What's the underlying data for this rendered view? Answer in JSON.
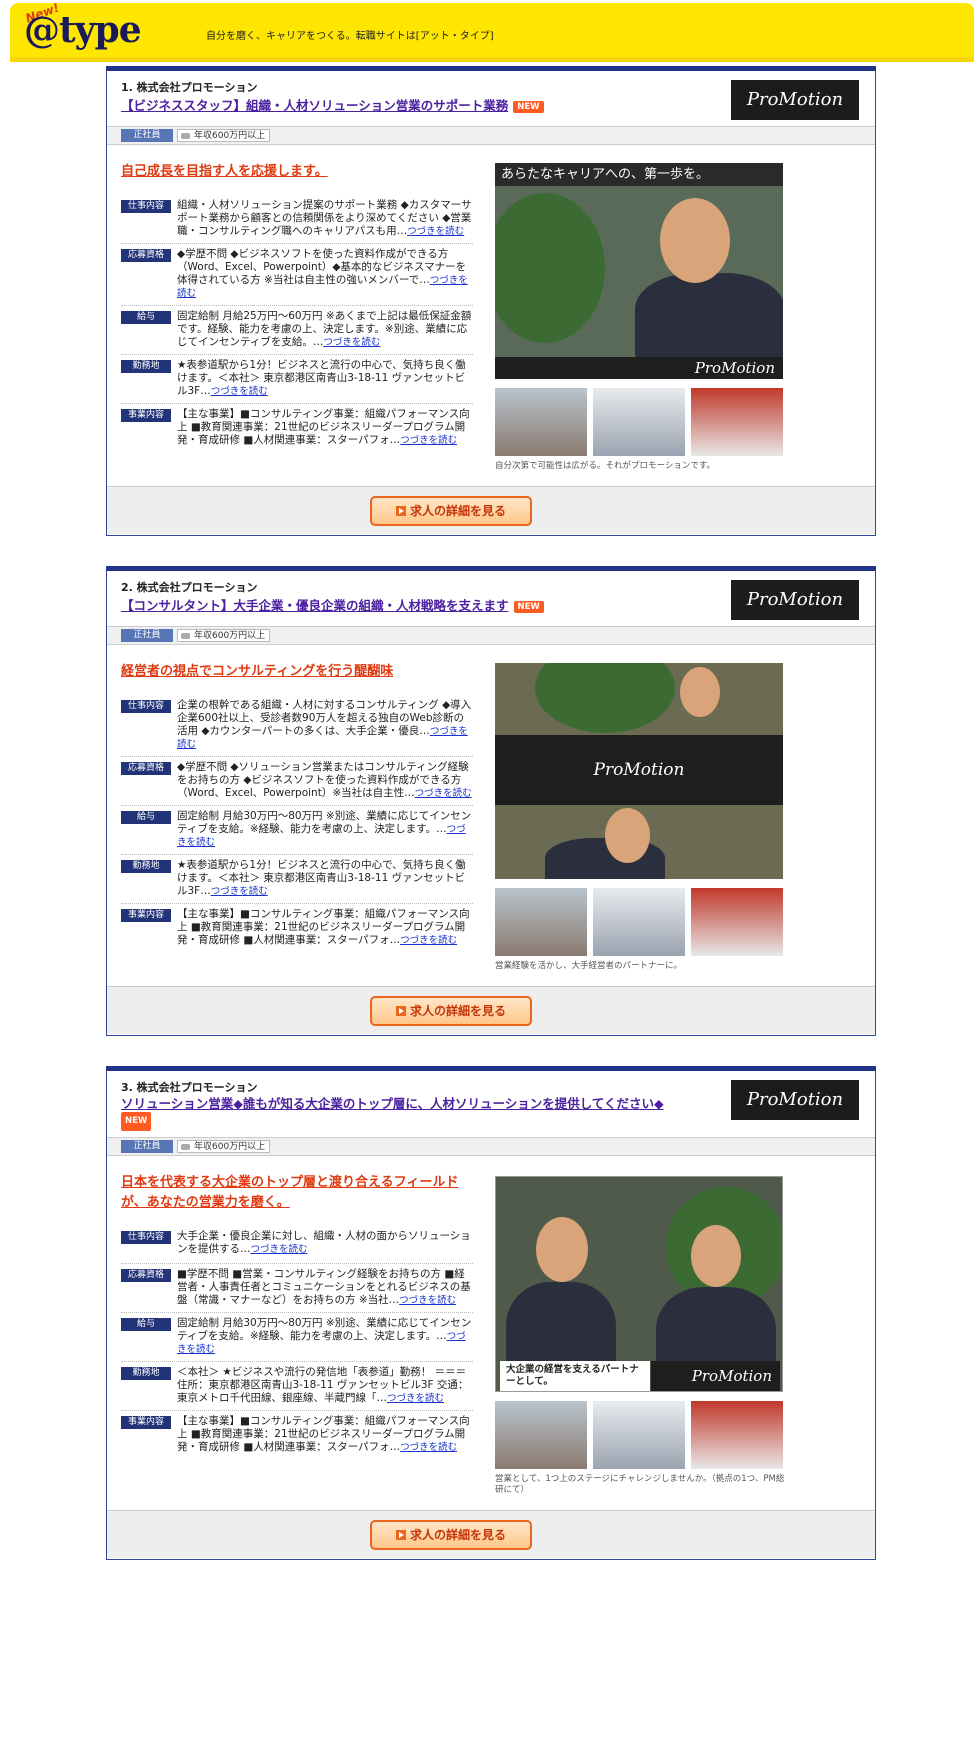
{
  "header": {
    "logo": "@type",
    "logo_badge": "New!",
    "tagline": "自分を磨く、キャリアをつくる。転職サイトは[アット・タイプ]"
  },
  "common": {
    "employment": "正社員",
    "salary": "年収600万円以上",
    "company_logo": "ProMotion",
    "new_badge": "NEW",
    "more": "つづきを読む",
    "detail_button": "求人の詳細を見る",
    "labels": {
      "work": "仕事内容",
      "req": "応募資格",
      "pay": "給与",
      "loc": "勤務地",
      "biz": "事業内容"
    }
  },
  "jobs": [
    {
      "company": "1. 株式会社プロモーション",
      "title": "【ビジネススタッフ】組織・人材ソリューション営業のサポート業務",
      "catch": "自己成長を目指す人を応援します。",
      "photo_caption": "あらたなキャリアへの、第一歩を。",
      "work": "組織・人材ソリューション提案のサポート業務 ◆カスタマーサポート業務から顧客との信頼関係をより深めてください ◆営業職・コンサルティング職へのキャリアパスも用…",
      "req": "◆学歴不問 ◆ビジネスソフトを使った資料作成ができる方（Word、Excel、Powerpoint）◆基本的なビジネスマナーを体得されている方 ※当社は自主性の強いメンバーで…",
      "pay": "固定給制 月給25万円～60万円 ※あくまで上記は最低保証金額です。経験、能力を考慮の上、決定します。※別途、業績に応じてインセンティブを支給。…",
      "loc": "★表参道駅から1分！ビジネスと流行の中心で、気持ち良く働けます。＜本社＞ 東京都港区南青山3-18-11 ヴァンセットビル3F…",
      "biz": "【主な事業】■コンサルティング事業：組織パフォーマンス向上 ■教育関連事業：21世紀のビジネスリーダープログラム開発・育成研修 ■人材関連事業：スターパフォ…",
      "sub_caption": "自分次第で可能性は広がる。それがプロモーションです。"
    },
    {
      "company": "2. 株式会社プロモーション",
      "title": "【コンサルタント】大手企業・優良企業の組織・人材戦略を支えます",
      "catch": "経営者の視点でコンサルティングを行う醍醐味",
      "photo_caption": "",
      "work": "企業の根幹である組織・人材に対するコンサルティング ◆導入企業600社以上、受診者数90万人を超える独自のWeb診断の活用 ◆カウンターパートの多くは、大手企業・優良…",
      "req": "◆学歴不問 ◆ソリューション営業またはコンサルティング経験をお持ちの方 ◆ビジネスソフトを使った資料作成ができる方（Word、Excel、Powerpoint）※当社は自主性…",
      "pay": "固定給制 月給30万円～80万円 ※別途、業績に応じてインセンティブを支給。※経験、能力を考慮の上、決定します。…",
      "loc": "★表参道駅から1分！ビジネスと流行の中心で、気持ち良く働けます。＜本社＞ 東京都港区南青山3-18-11 ヴァンセットビル3F…",
      "biz": "【主な事業】■コンサルティング事業：組織パフォーマンス向上 ■教育関連事業：21世紀のビジネスリーダープログラム開発・育成研修 ■人材関連事業：スターパフォ…",
      "sub_caption": "営業経験を活かし、大手経営者のパートナーに。"
    },
    {
      "company": "3. 株式会社プロモーション",
      "title": "ソリューション営業◆誰もが知る大企業のトップ層に、人材ソリューションを提供してください◆",
      "catch": "日本を代表する大企業のトップ層と渡り合えるフィールドが、あなたの営業力を磨く。",
      "photo_caption": "大企業の経営を支えるパートナーとして。",
      "work": "大手企業・優良企業に対し、組織・人材の面からソリューションを提供する…",
      "req": "■学歴不問 ■営業・コンサルティング経験をお持ちの方 ■経営者・人事責任者とコミュニケーションをとれるビジネスの基盤（常識・マナーなど）をお持ちの方 ※当社…",
      "pay": "固定給制 月給30万円～80万円 ※別途、業績に応じてインセンティブを支給。※経験、能力を考慮の上、決定します。…",
      "loc": "＜本社＞ ★ビジネスや流行の発信地「表参道」勤務！ ＝＝＝ 住所：東京都港区南青山3-18-11 ヴァンセットビル3F 交通：東京メトロ千代田線、銀座線、半蔵門線「…",
      "biz": "【主な事業】■コンサルティング事業：組織パフォーマンス向上 ■教育関連事業：21世紀のビジネスリーダープログラム開発・育成研修 ■人材関連事業：スターパフォ…",
      "sub_caption": "営業として、1つ上のステージにチャレンジしませんか。（拠点の1つ、PM総研にて）"
    }
  ]
}
